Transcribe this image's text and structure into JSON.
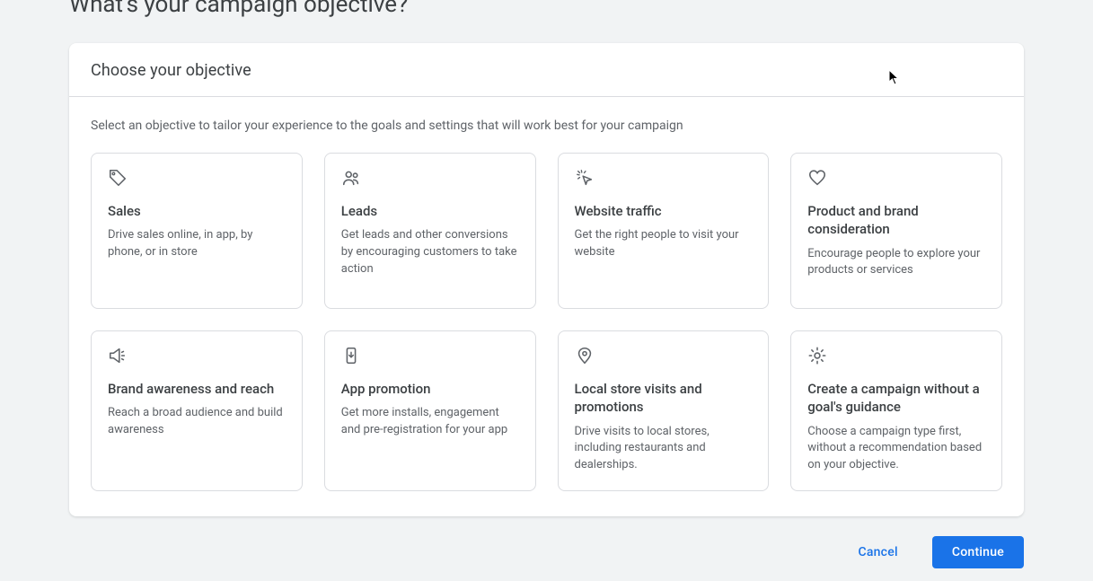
{
  "page": {
    "title": "What's your campaign objective?"
  },
  "card": {
    "header": "Choose your objective",
    "subtitle": "Select an objective to tailor your experience to the goals and settings that will work best for your campaign"
  },
  "objectives": [
    {
      "icon": "tag",
      "title": "Sales",
      "desc": "Drive sales online, in app, by phone, or in store"
    },
    {
      "icon": "people",
      "title": "Leads",
      "desc": "Get leads and other conversions by encouraging customers to take action"
    },
    {
      "icon": "click",
      "title": "Website traffic",
      "desc": "Get the right people to visit your website"
    },
    {
      "icon": "heart",
      "title": "Product and brand consideration",
      "desc": "Encourage people to explore your products or services"
    },
    {
      "icon": "megaphone",
      "title": "Brand awareness and reach",
      "desc": "Reach a broad audience and build awareness"
    },
    {
      "icon": "phone",
      "title": "App promotion",
      "desc": "Get more installs, engagement and pre-registration for your app"
    },
    {
      "icon": "pin",
      "title": "Local store visits and promotions",
      "desc": "Drive visits to local stores, including restaurants and dealerships."
    },
    {
      "icon": "gear",
      "title": "Create a campaign without a goal's guidance",
      "desc": "Choose a campaign type first, without a recommendation based on your objective."
    }
  ],
  "actions": {
    "cancel": "Cancel",
    "continue": "Continue"
  }
}
